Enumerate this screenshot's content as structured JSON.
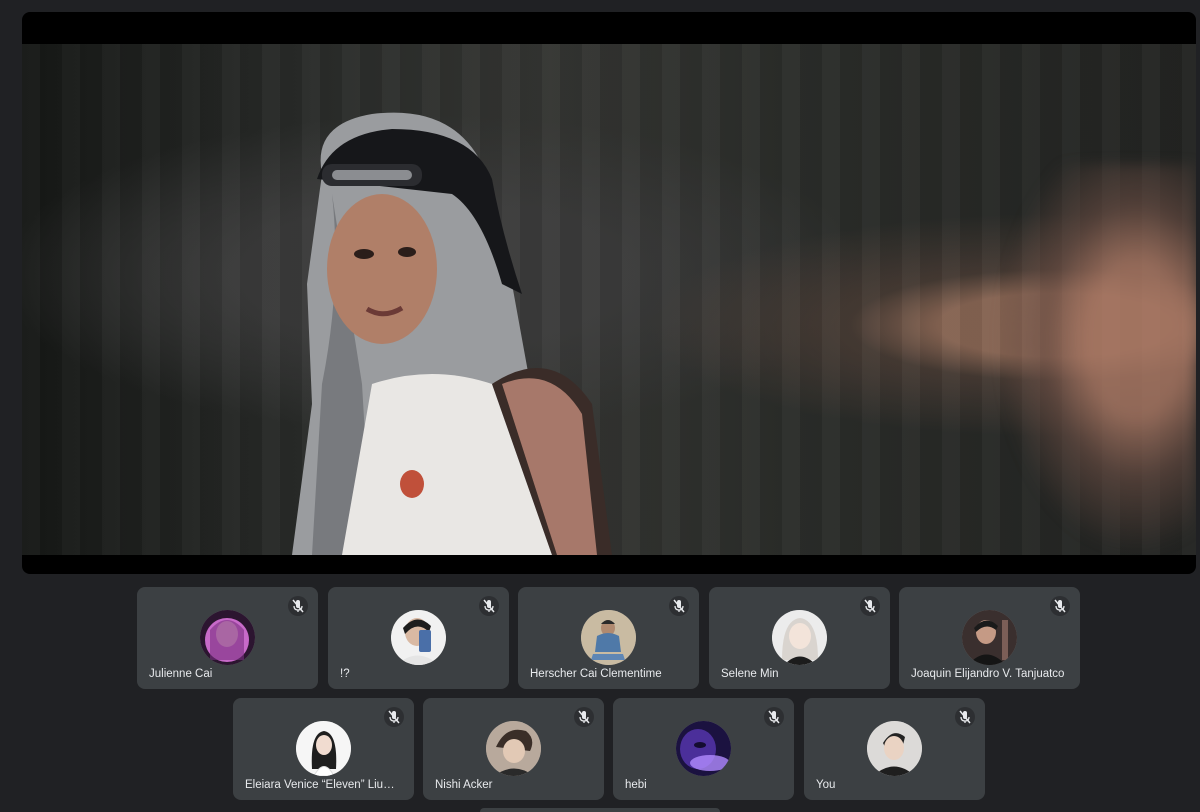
{
  "meeting": {
    "presentation": {
      "content": "video-frame"
    },
    "participants_row1": [
      {
        "name": "Julienne Cai",
        "muted": true,
        "avatar_tone": "#c86ac9"
      },
      {
        "name": "!?",
        "muted": true,
        "avatar_tone": "#d9d9d9"
      },
      {
        "name": "Herscher Cai Clementime",
        "muted": true,
        "avatar_tone": "#b8a88e"
      },
      {
        "name": "Selene Min",
        "muted": true,
        "avatar_tone": "#e6e6e6"
      },
      {
        "name": "Joaquin Elijandro V. Tanjuatco",
        "muted": true,
        "avatar_tone": "#5a4a48"
      }
    ],
    "participants_row2": [
      {
        "name": "Eleiara Venice “Eleven” Liu—P...",
        "muted": true,
        "avatar_tone": "#f2f2f2"
      },
      {
        "name": "Nishi Acker",
        "muted": true,
        "avatar_tone": "#c7b7a9"
      },
      {
        "name": "hebi",
        "muted": true,
        "avatar_tone": "#3b2a6e"
      },
      {
        "name": "You",
        "muted": true,
        "avatar_tone": "#d4d2d0"
      }
    ]
  },
  "icons": {
    "mute": "mic-off-icon"
  }
}
